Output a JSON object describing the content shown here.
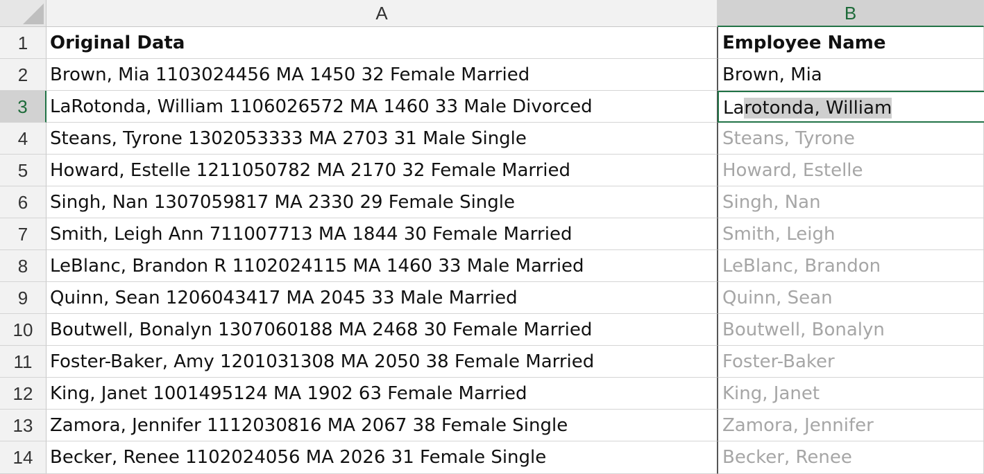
{
  "columns": [
    "A",
    "B"
  ],
  "selected_column": "B",
  "selected_row": 3,
  "rows": [
    {
      "num": "1",
      "a": "Original Data",
      "b": "Employee Name"
    },
    {
      "num": "2",
      "a": "Brown, Mia 1103024456 MA 1450 32 Female Married",
      "b": "Brown, Mia"
    },
    {
      "num": "3",
      "a": "LaRotonda, William 1106026572 MA 1460 33 Male Divorced",
      "b_prefix": "La",
      "b_highlight": "rotonda, William"
    },
    {
      "num": "4",
      "a": "Steans, Tyrone 1302053333 MA 2703 31 Male Single",
      "b": "Steans, Tyrone"
    },
    {
      "num": "5",
      "a": "Howard, Estelle 1211050782 MA 2170 32 Female Married",
      "b": "Howard, Estelle"
    },
    {
      "num": "6",
      "a": "Singh, Nan 1307059817 MA 2330 29 Female Single",
      "b": "Singh, Nan"
    },
    {
      "num": "7",
      "a": "Smith, Leigh Ann 711007713 MA 1844 30 Female Married",
      "b": "Smith, Leigh"
    },
    {
      "num": "8",
      "a": "LeBlanc, Brandon R 1102024115 MA 1460 33 Male Married",
      "b": "LeBlanc, Brandon"
    },
    {
      "num": "9",
      "a": "Quinn, Sean 1206043417 MA 2045 33 Male Married",
      "b": "Quinn, Sean"
    },
    {
      "num": "10",
      "a": "Boutwell, Bonalyn 1307060188 MA 2468 30 Female Married",
      "b": "Boutwell, Bonalyn"
    },
    {
      "num": "11",
      "a": "Foster-Baker, Amy 1201031308 MA 2050 38 Female Married",
      "b": "Foster-Baker"
    },
    {
      "num": "12",
      "a": "King, Janet 1001495124 MA 1902 63 Female Married",
      "b": "King, Janet"
    },
    {
      "num": "13",
      "a": "Zamora, Jennifer 1112030816 MA 2067 38 Female Single",
      "b": "Zamora, Jennifer"
    },
    {
      "num": "14",
      "a": "Becker, Renee 1102024056 MA 2026 31 Female Single",
      "b": "Becker, Renee"
    }
  ],
  "colors": {
    "accent": "#217346",
    "ghost_text": "#a6a6a6",
    "header_bg": "#f2f2f2"
  }
}
